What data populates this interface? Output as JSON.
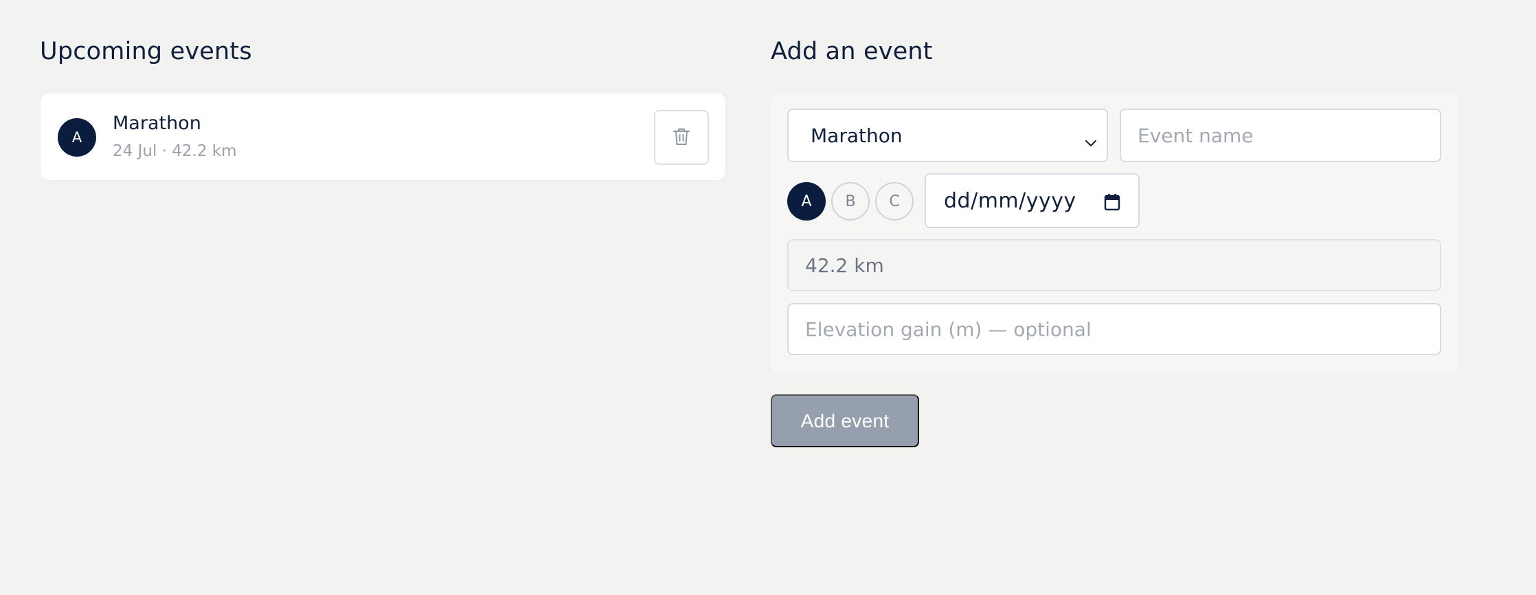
{
  "events_section": {
    "title": "Upcoming events",
    "events": [
      {
        "group": "A",
        "name": "Marathon",
        "meta": "24 Jul · 42.2 km",
        "delete_icon": "trash-icon"
      }
    ]
  },
  "form_section": {
    "title": "Add an event",
    "event_type_select": {
      "value": "Marathon",
      "icon": "chevron-down-icon"
    },
    "event_name_input": {
      "placeholder": "Event name",
      "value": ""
    },
    "groups": [
      {
        "label": "A",
        "selected": true
      },
      {
        "label": "B",
        "selected": false
      },
      {
        "label": "C",
        "selected": false
      }
    ],
    "date_input": {
      "placeholder": "dd/mm/yyyy",
      "icon": "calendar-icon"
    },
    "distance_input": {
      "value": "42.2 km"
    },
    "elevation_input": {
      "placeholder": "Elevation gain (m) — optional",
      "value": ""
    },
    "submit_label": "Add event"
  },
  "colors": {
    "background": "#f2f2f0",
    "navy": "#0b1d3f",
    "button_disabled": "#959fae",
    "border": "#d7dbe1",
    "muted_text": "#9aa1ad"
  }
}
